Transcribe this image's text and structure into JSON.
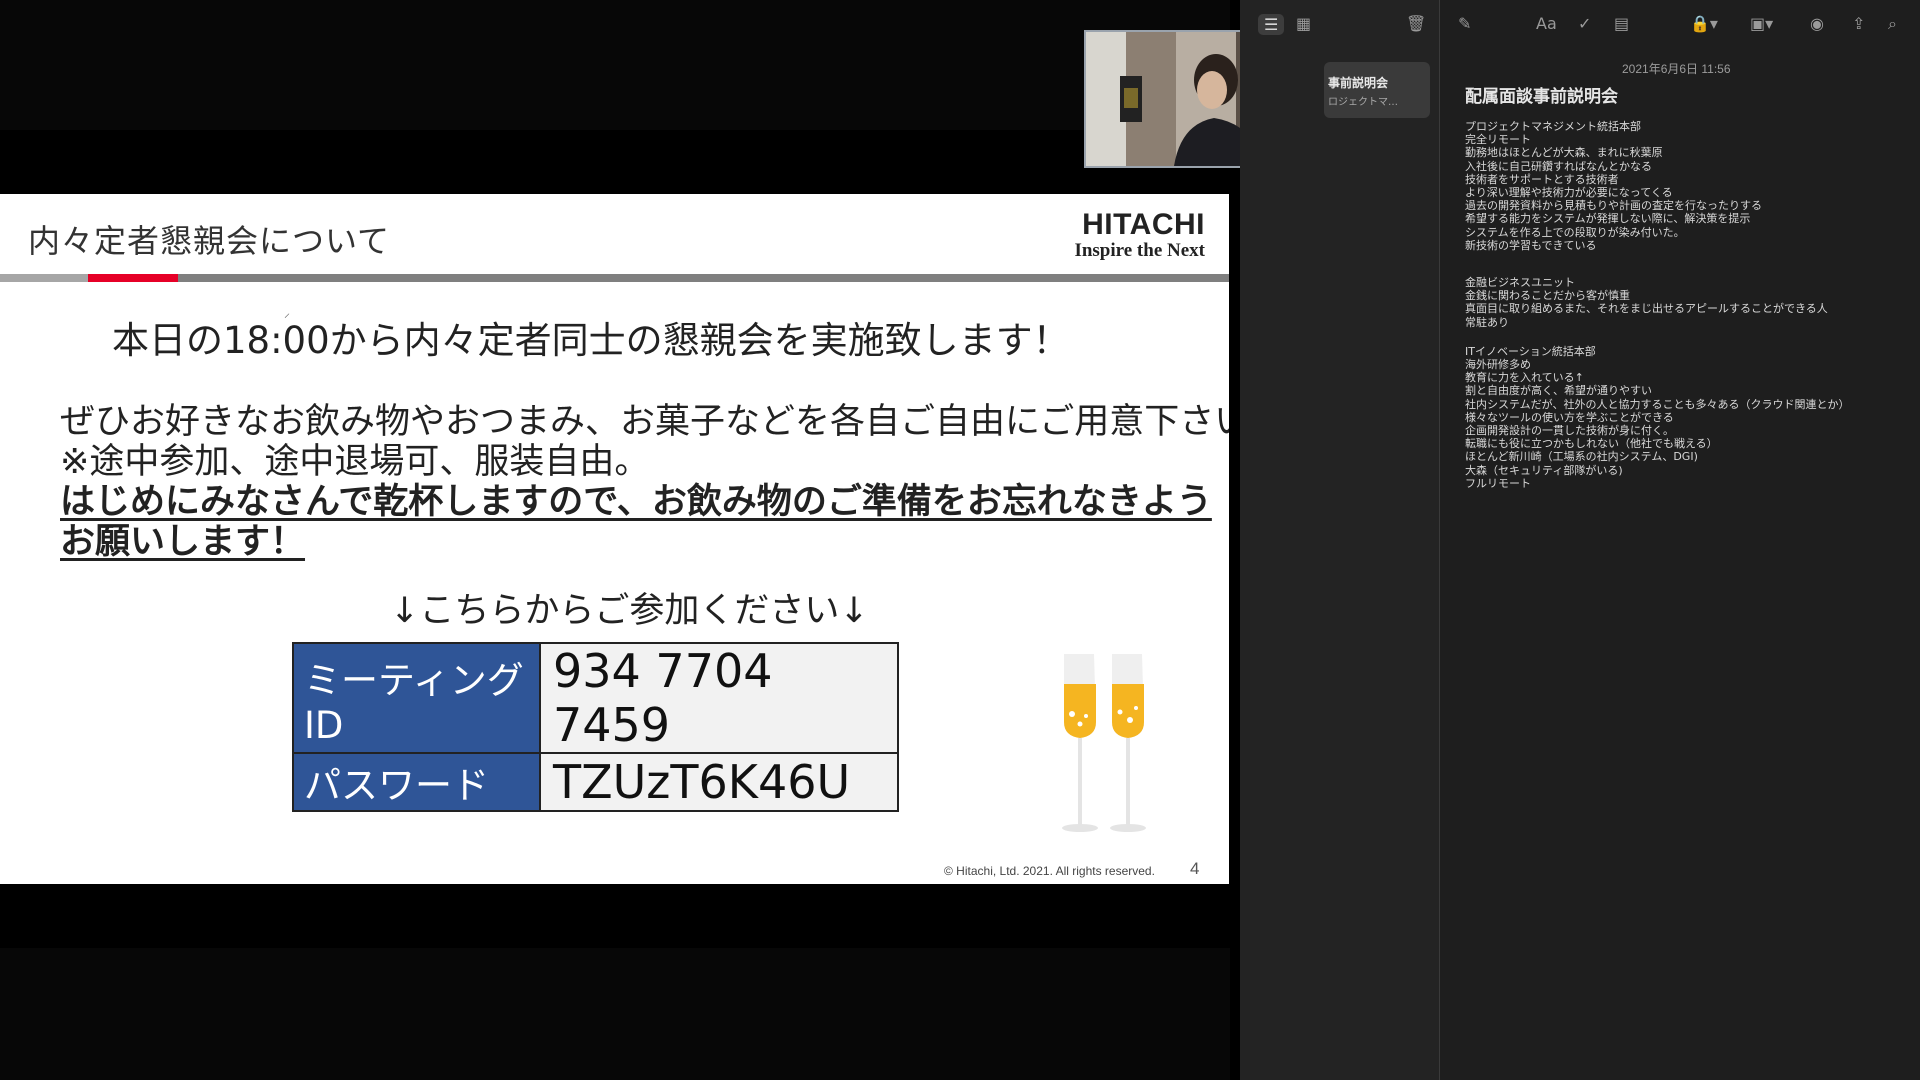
{
  "slide": {
    "title": "内々定者懇親会について",
    "logo_brand": "HITACHI",
    "logo_tagline": "Inspire the Next",
    "headline": "本日の18:00から内々定者同士の懇親会を実施致します！",
    "body_lines": [
      "ぜひお好きなお飲み物やおつまみ、お菓子などを各自ご自由にご用意下さい。",
      "※途中参加、途中退場可、服装自由。"
    ],
    "emphasis_lines": [
      "はじめにみなさんで乾杯しますので、お飲み物のご準備をお忘れなきよう",
      "お願いします！"
    ],
    "join_text": "↓こちらからご参加ください↓",
    "meeting_id_label": "ミーティングID",
    "meeting_id_value": "934 7704 7459",
    "password_label": "パスワード",
    "password_value": "TZUzT6K46U",
    "copyright": "© Hitachi, Ltd. 2021. All rights reserved.",
    "page_number": "4",
    "colors": {
      "accent_red": "#e60027",
      "table_blue": "#2f5597",
      "champagne": "#f5b521"
    }
  },
  "notes_app": {
    "toolbar_icons": [
      "list-view-icon",
      "gallery-view-icon",
      "trash-icon",
      "compose-icon",
      "format-text-icon",
      "checklist-icon",
      "table-icon",
      "lock-icon",
      "media-icon",
      "collaborate-icon",
      "share-icon",
      "search-icon"
    ],
    "format_label": "Aa",
    "list": [
      {
        "title": "事前説明会",
        "subtitle": "ロジェクトマ…"
      }
    ],
    "note": {
      "date": "2021年6月6日 11:56",
      "title": "配属面談事前説明会",
      "section1": [
        "プロジェクトマネジメント統括本部",
        "完全リモート",
        "勤務地はほとんどが大森、まれに秋葉原",
        "入社後に自己研鑽すればなんとかなる",
        "技術者をサポートとする技術者",
        "より深い理解や技術力が必要になってくる",
        "過去の開発資料から見積もりや計画の査定を行なったりする",
        "希望する能力をシステムが発揮しない際に、解決策を提示",
        "システムを作る上での段取りが染み付いた。",
        "新技術の学習もできている"
      ],
      "section2": [
        "金融ビジネスユニット",
        "金銭に関わることだから客が慎重",
        "真面目に取り組めるまた、それをまじ出せるアピールすることができる人",
        "常駐あり"
      ],
      "section3": [
        "ITイノベーション統括本部",
        "海外研修多め",
        "教育に力を入れている↑",
        "割と自由度が高く、希望が通りやすい",
        "社内システムだが、社外の人と協力することも多々ある（クラウド関連とか）",
        "様々なツールの使い方を学ぶことができる",
        "企画開発設計の一貫した技術が身に付く。",
        "転職にも役に立つかもしれない（他社でも戦える）",
        "ほとんど新川崎（工場系の社内システム、DGI)",
        "大森（セキュリティ部隊がいる)",
        "フルリモート"
      ]
    }
  }
}
